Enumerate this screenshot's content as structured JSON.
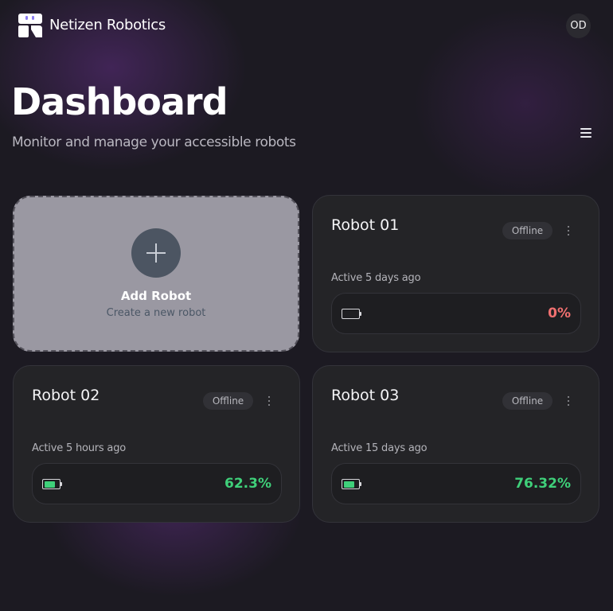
{
  "app": {
    "name": "Netizen Robotics",
    "logo_icon": "netizen-robot-logo-icon",
    "user_initials": "OD"
  },
  "page": {
    "title": "Dashboard",
    "subtitle": "Monitor and manage your accessible robots",
    "menu_icon": "hamburger-menu-icon"
  },
  "add_card": {
    "title": "Add Robot",
    "subtitle": "Create a new robot",
    "icon": "plus-icon"
  },
  "colors": {
    "background": "#1c1a22",
    "card": "#242427",
    "battery_low": "#f07070",
    "battery_ok": "#3fd07a"
  },
  "robots": [
    {
      "name": "Robot 01",
      "status": "Offline",
      "last_active": "Active 5 days ago",
      "battery_label": "0%",
      "battery_level": 0,
      "battery_color": "#f07070"
    },
    {
      "name": "Robot 02",
      "status": "Offline",
      "last_active": "Active 5 hours ago",
      "battery_label": "62.3%",
      "battery_level": 62.3,
      "battery_color": "#3fd07a"
    },
    {
      "name": "Robot 03",
      "status": "Offline",
      "last_active": "Active 15 days ago",
      "battery_label": "76.32%",
      "battery_level": 76.32,
      "battery_color": "#3fd07a"
    }
  ]
}
